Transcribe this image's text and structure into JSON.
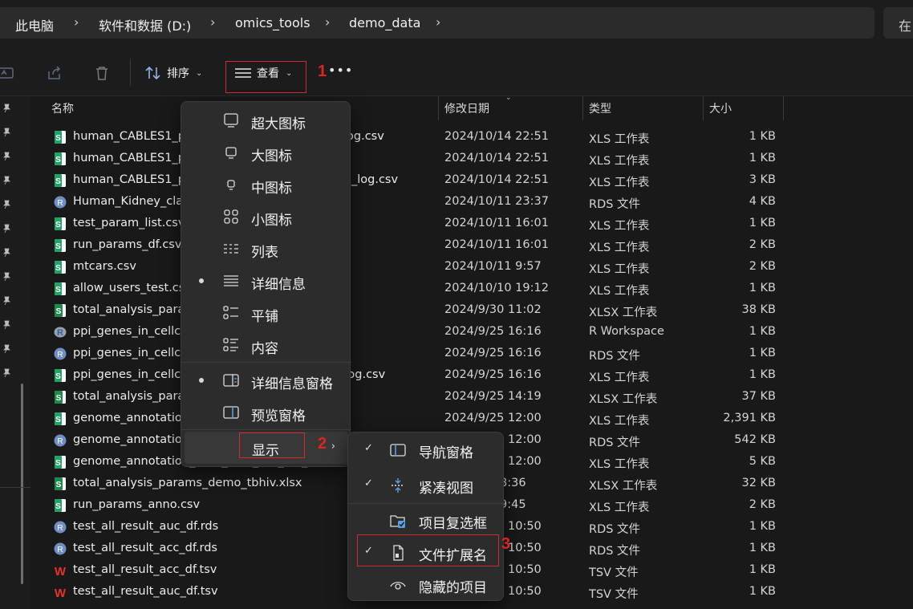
{
  "breadcrumb": [
    "此电脑",
    "软件和数据 (D:)",
    "omics_tools",
    "demo_data"
  ],
  "search_hint": "在",
  "toolbar": {
    "sort_label": "排序",
    "view_label": "查看",
    "more_label": "•••"
  },
  "annotations": [
    "1",
    "2",
    "3"
  ],
  "columns": {
    "name": "名称",
    "date": "修改日期",
    "type": "类型",
    "size": "大小"
  },
  "files": [
    {
      "name": "human_CABLES1_p",
      "suffix": "log.csv",
      "date": "2024/10/14 22:51",
      "type": "XLS 工作表",
      "size": "1 KB",
      "icon": "csv"
    },
    {
      "name": "human_CABLES1_p",
      "suffix": "",
      "date": "2024/10/14 22:51",
      "type": "XLS 工作表",
      "size": "1 KB",
      "icon": "csv"
    },
    {
      "name": "human_CABLES1_p",
      "suffix": "_log.csv",
      "date": "2024/10/14 22:51",
      "type": "XLS 工作表",
      "size": "3 KB",
      "icon": "csv"
    },
    {
      "name": "Human_Kidney_cla",
      "suffix": "",
      "date": "2024/10/11 23:37",
      "type": "RDS 文件",
      "size": "4 KB",
      "icon": "rds"
    },
    {
      "name": "test_param_list.csv",
      "suffix": "",
      "date": "2024/10/11 16:01",
      "type": "XLS 工作表",
      "size": "1 KB",
      "icon": "csv"
    },
    {
      "name": "run_params_df.csv",
      "suffix": "",
      "date": "2024/10/11 16:01",
      "type": "XLS 工作表",
      "size": "2 KB",
      "icon": "csv"
    },
    {
      "name": "mtcars.csv",
      "suffix": "",
      "date": "2024/10/11 9:57",
      "type": "XLS 工作表",
      "size": "2 KB",
      "icon": "csv"
    },
    {
      "name": "allow_users_test.cs",
      "suffix": "",
      "date": "2024/10/10 19:12",
      "type": "XLS 工作表",
      "size": "1 KB",
      "icon": "csv"
    },
    {
      "name": "total_analysis_para",
      "suffix": "",
      "date": "2024/9/30 11:02",
      "type": "XLSX 工作表",
      "size": "38 KB",
      "icon": "xlsx"
    },
    {
      "name": "ppi_genes_in_cellc",
      "suffix": "",
      "date": "2024/9/25 16:16",
      "type": "R Workspace",
      "size": "1 KB",
      "icon": "rws"
    },
    {
      "name": "ppi_genes_in_cellc",
      "suffix": "",
      "date": "2024/9/25 16:16",
      "type": "RDS 文件",
      "size": "1 KB",
      "icon": "rds"
    },
    {
      "name": "ppi_genes_in_cellc",
      "suffix": "res_log.csv",
      "date": "2024/9/25 16:16",
      "type": "XLS 工作表",
      "size": "1 KB",
      "icon": "csv"
    },
    {
      "name": "total_analysis_para",
      "suffix": "",
      "date": "2024/9/25 14:19",
      "type": "XLSX 工作表",
      "size": "37 KB",
      "icon": "xlsx"
    },
    {
      "name": "genome_annotatio",
      "suffix": "",
      "date": "2024/9/25 12:00",
      "type": "XLS 工作表",
      "size": "2,391 KB",
      "icon": "csv"
    },
    {
      "name": "genome_annotatio",
      "suffix": "",
      "date": "12:00",
      "type": "RDS 文件",
      "size": "542 KB",
      "icon": "rds"
    },
    {
      "name": "genome_annotation_total_final_run_res_log.cs",
      "suffix": "",
      "date": "12:00",
      "type": "XLS 工作表",
      "size": "5 KB",
      "icon": "csv"
    },
    {
      "name": "total_analysis_params_demo_tbhiv.xlsx",
      "suffix": "",
      "date": "8:36",
      "type": "XLSX 工作表",
      "size": "32 KB",
      "icon": "xlsx"
    },
    {
      "name": "run_params_anno.csv",
      "suffix": "",
      "date": "9:45",
      "type": "XLS 工作表",
      "size": "2 KB",
      "icon": "csv"
    },
    {
      "name": "test_all_result_auc_df.rds",
      "suffix": "",
      "date": "10:50",
      "type": "RDS 文件",
      "size": "1 KB",
      "icon": "rds"
    },
    {
      "name": "test_all_result_acc_df.rds",
      "suffix": "",
      "date": "10:50",
      "type": "RDS 文件",
      "size": "1 KB",
      "icon": "rds"
    },
    {
      "name": "test_all_result_acc_df.tsv",
      "suffix": "",
      "date": "10:50",
      "type": "TSV 文件",
      "size": "1 KB",
      "icon": "tsv"
    },
    {
      "name": "test_all_result_auc_df.tsv",
      "suffix": "",
      "date": "10:50",
      "type": "TSV 文件",
      "size": "1 KB",
      "icon": "tsv"
    }
  ],
  "view_menu": {
    "items": [
      "超大图标",
      "大图标",
      "中图标",
      "小图标",
      "列表",
      "详细信息",
      "平铺",
      "内容",
      "详细信息窗格",
      "预览窗格",
      "显示"
    ],
    "selected": [
      "详细信息",
      "详细信息窗格"
    ]
  },
  "show_submenu": {
    "items": [
      {
        "label": "导航窗格",
        "checked": true
      },
      {
        "label": "紧凑视图",
        "checked": true
      },
      {
        "label": "项目复选框",
        "checked": false
      },
      {
        "label": "文件扩展名",
        "checked": true
      },
      {
        "label": "隐藏的项目",
        "checked": false
      }
    ],
    "check_glyph": "✓"
  },
  "colors": {
    "background": "#191919",
    "menu": "#2c2c2c",
    "annotation_red": "#e0241f",
    "csv_green": "#21a366",
    "rds_blue": "#6f8fc4",
    "tsv_red": "#e8322a"
  }
}
